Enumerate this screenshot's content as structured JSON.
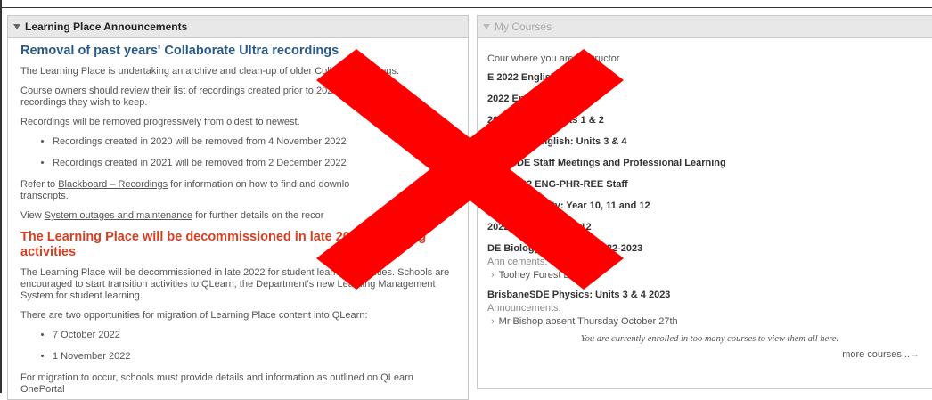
{
  "left_panel": {
    "title": "Learning Place Announcements",
    "heading1": "Removal of past years' Collaborate Ultra recordings",
    "p1": "The Learning Place is undertaking an archive and clean-up of older Collabor",
    "p1_tail": "ecordings.",
    "p2_line1": "Course owners should review their list of recordings created prior to 202",
    "p2_line2": "recordings they wish to keep.",
    "p3": "Recordings will be removed progressively from oldest to newest.",
    "bullets1": [
      "Recordings created in 2020 will be removed from 4 November 2022",
      "Recordings created in 2021 will be removed from 2 December 2022"
    ],
    "p4_prefix": "Refer to ",
    "p4_link": "Blackboard – Recordings",
    "p4_suffix": " for information on how to find and downlo",
    "p4_line2": "transcripts.",
    "p5_prefix": "View ",
    "p5_link": "System outages and maintenance",
    "p5_suffix": " for further details on the recor",
    "heading2_a": "The Learning Place will be decommissioned in late 2022",
    "heading2_b": "t learning",
    "heading2_line2": "activities",
    "p6": "The Learning Place will be decommissioned in late 2022 for student learning activities. Schools are encouraged to start transition activities to QLearn, the Department's new Learning Management System for student learning.",
    "p7": "There are two opportunities for migration of Learning Place content into QLearn:",
    "bullets2": [
      "7 October 2022",
      "1 November 2022"
    ],
    "p8": "For migration to occur, schools must provide details and information as outlined on QLearn OnePortal"
  },
  "right_panel": {
    "title": "My Courses",
    "intro": "Cour   where you are: Instructor",
    "courses": [
      "E 2022 English: Year 7",
      "2022 English: Year 9",
      "2022 English: Units 1 & 2",
      "SDE 2022 English: Units 3 & 4",
      "baneSDE Staff Meetings and Professional Learning",
      "SDE 2022 ENG-PHR-REE Staff",
      "022 Community: Year 10, 11 and 12",
      "2022 Connect: Year 12"
    ],
    "course_blocks": [
      {
        "title": "DE Biology Units 3 & 4 2022-2023",
        "label": "Ann   cements:",
        "item": "Toohey Forest Data"
      },
      {
        "title": "BrisbaneSDE Physics: Units 3 & 4 2023",
        "label": "Announcements:",
        "item": "Mr Bishop absent Thursday October 27th"
      }
    ],
    "enrolled_note": "You are currently enrolled in too many courses to view them all here.",
    "more_courses": "more courses...",
    "more_arrow": "→"
  },
  "overlay": {
    "color": "#ff0000"
  },
  "icons": {
    "collapse": "triangle-down-icon",
    "chevron": "chevron-right-icon",
    "close": "big-x-icon"
  }
}
